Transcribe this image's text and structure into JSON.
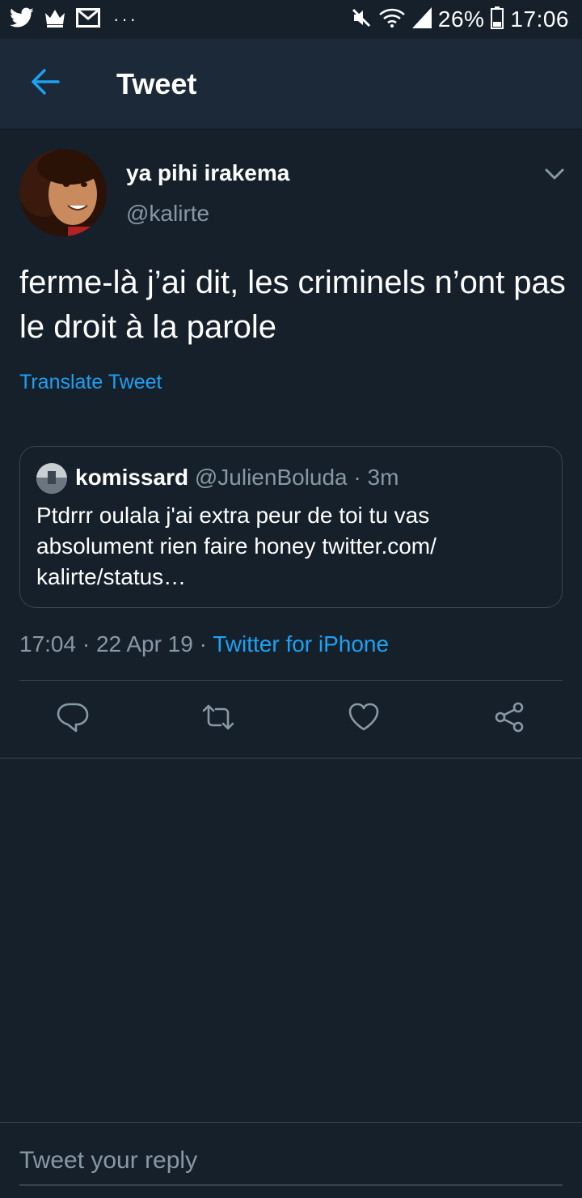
{
  "status_bar": {
    "battery": "26%",
    "time": "17:06",
    "more": "···",
    "icons": [
      "twitter-icon",
      "crown-icon",
      "gmail-icon",
      "mute-icon",
      "wifi-icon",
      "signal-icon",
      "battery-icon"
    ]
  },
  "header": {
    "title": "Tweet"
  },
  "tweet": {
    "display_name": "ya pihi irakema",
    "handle": "@kalirte",
    "text": "ferme-là j’ai dit, les criminels n’ont pas le droit à la parole",
    "translate": "Translate Tweet",
    "quoted": {
      "name": "komissard",
      "handle": "@JulienBoluda",
      "time": " · 3m",
      "text": "Ptdrrr oulala j'ai extra peur de toi tu vas absolument rien faire honey twitter.com/ kalirte/status…"
    },
    "meta": {
      "time": "17:04 · 22 Apr 19 · ",
      "source": "Twitter for iPhone"
    }
  },
  "actions": [
    "reply-icon",
    "retweet-icon",
    "like-icon",
    "share-icon"
  ],
  "reply": {
    "placeholder": "Tweet your reply"
  },
  "colors": {
    "background": "#15202b",
    "header": "#1c2938",
    "accent": "#1da1f2",
    "muted": "#8899a6",
    "border": "#38444d"
  }
}
